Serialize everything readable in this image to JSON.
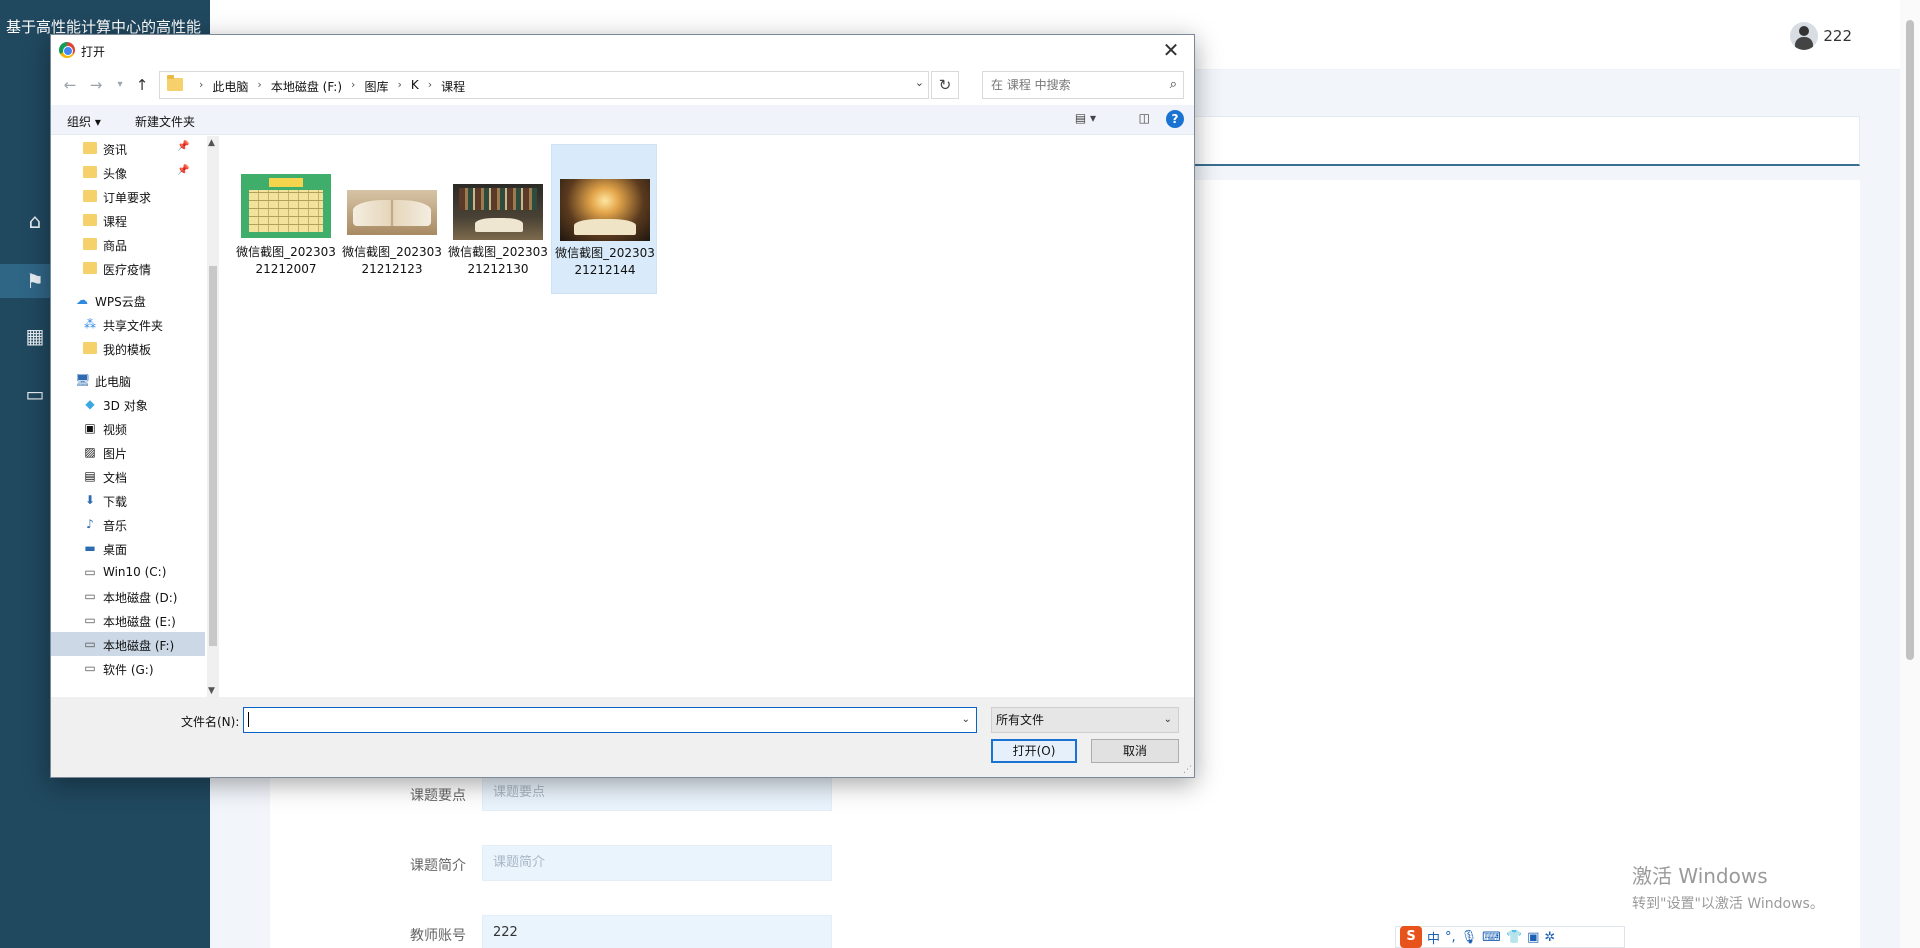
{
  "app": {
    "title": "基于高性能计算中心的高性能",
    "username": "222",
    "form": [
      {
        "label": "课题要点",
        "value": "",
        "placeholder": "课题要点"
      },
      {
        "label": "课题简介",
        "value": "",
        "placeholder": "课题简介"
      },
      {
        "label": "教师账号",
        "value": "222",
        "placeholder": ""
      }
    ],
    "colors": {
      "sidebar": "#20485f",
      "main_bg": "#f2f6fb",
      "input_bg": "#eaf4fd"
    }
  },
  "sidebar_icons": [
    "home-icon",
    "flag-icon",
    "grid-icon",
    "card-icon"
  ],
  "dialog": {
    "title": "打开",
    "close_glyph": "✕",
    "breadcrumbs": [
      "此电脑",
      "本地磁盘 (F:)",
      "图库",
      "K",
      "课程"
    ],
    "search_placeholder": "在 课程 中搜索",
    "toolbar": {
      "organize": "组织 ▾",
      "new_folder": "新建文件夹"
    },
    "nav_items": [
      {
        "label": "资讯",
        "icon": "folder-icon",
        "pinned": true
      },
      {
        "label": "头像",
        "icon": "folder-icon",
        "pinned": true
      },
      {
        "label": "订单要求",
        "icon": "folder-icon",
        "pinned": false
      },
      {
        "label": "课程",
        "icon": "folder-icon",
        "pinned": false
      },
      {
        "label": "商品",
        "icon": "folder-icon",
        "pinned": false
      },
      {
        "label": "医疗疫情",
        "icon": "folder-icon",
        "pinned": false
      },
      {
        "label": "WPS云盘",
        "icon": "cloud-icon",
        "pinned": false
      },
      {
        "label": "共享文件夹",
        "icon": "share-icon",
        "pinned": false
      },
      {
        "label": "我的模板",
        "icon": "folder-icon",
        "pinned": false
      },
      {
        "label": "此电脑",
        "icon": "computer-icon",
        "pinned": false
      },
      {
        "label": "3D 对象",
        "icon": "cube-icon",
        "pinned": false
      },
      {
        "label": "视频",
        "icon": "video-icon",
        "pinned": false
      },
      {
        "label": "图片",
        "icon": "picture-icon",
        "pinned": false
      },
      {
        "label": "文档",
        "icon": "document-icon",
        "pinned": false
      },
      {
        "label": "下载",
        "icon": "download-icon",
        "pinned": false
      },
      {
        "label": "音乐",
        "icon": "music-icon",
        "pinned": false
      },
      {
        "label": "桌面",
        "icon": "desktop-icon",
        "pinned": false
      },
      {
        "label": "Win10 (C:)",
        "icon": "drive-icon",
        "pinned": false
      },
      {
        "label": "本地磁盘 (D:)",
        "icon": "drive-icon",
        "pinned": false
      },
      {
        "label": "本地磁盘 (E:)",
        "icon": "drive-icon",
        "pinned": false
      },
      {
        "label": "本地磁盘 (F:)",
        "icon": "drive-icon",
        "pinned": false,
        "selected": true
      },
      {
        "label": "软件 (G:)",
        "icon": "drive-icon",
        "pinned": false
      }
    ],
    "files": [
      {
        "name": "微信截图_20230321212007",
        "thumb": "schedule"
      },
      {
        "name": "微信截图_20230321212123",
        "thumb": "book1"
      },
      {
        "name": "微信截图_20230321212130",
        "thumb": "book2"
      },
      {
        "name": "微信截图_20230321212144",
        "thumb": "book3",
        "selected": true
      }
    ],
    "filename_label": "文件名(N):",
    "filename_value": "",
    "filetype": "所有文件",
    "open_button": "打开(O)",
    "cancel_button": "取消"
  },
  "watermark": {
    "line1": "激活 Windows",
    "line2": "转到\"设置\"以激活 Windows。"
  },
  "ime": {
    "logo": "S",
    "mode": "中"
  }
}
